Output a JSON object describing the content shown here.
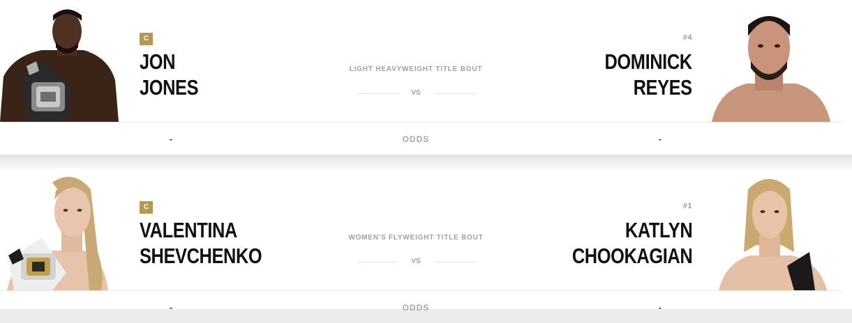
{
  "fights": [
    {
      "bout": "LIGHT HEAVYWEIGHT TITLE BOUT",
      "vs": "VS",
      "odds_label": "ODDS",
      "red": {
        "badge": "C",
        "name_line1": "JON",
        "name_line2": "JONES",
        "odds": "-"
      },
      "blue": {
        "rank": "#4",
        "name_line1": "DOMINICK",
        "name_line2": "REYES",
        "odds": "-"
      }
    },
    {
      "bout": "WOMEN'S FLYWEIGHT TITLE BOUT",
      "vs": "VS",
      "odds_label": "ODDS",
      "red": {
        "badge": "C",
        "name_line1": "VALENTINA",
        "name_line2": "SHEVCHENKO",
        "odds": "-"
      },
      "blue": {
        "rank": "#1",
        "name_line1": "KATLYN",
        "name_line2": "CHOOKAGIAN",
        "odds": "-"
      }
    }
  ],
  "colors": {
    "champion_badge": "#b29a55",
    "name_text": "#111111",
    "muted_text": "#a0a0a0"
  }
}
